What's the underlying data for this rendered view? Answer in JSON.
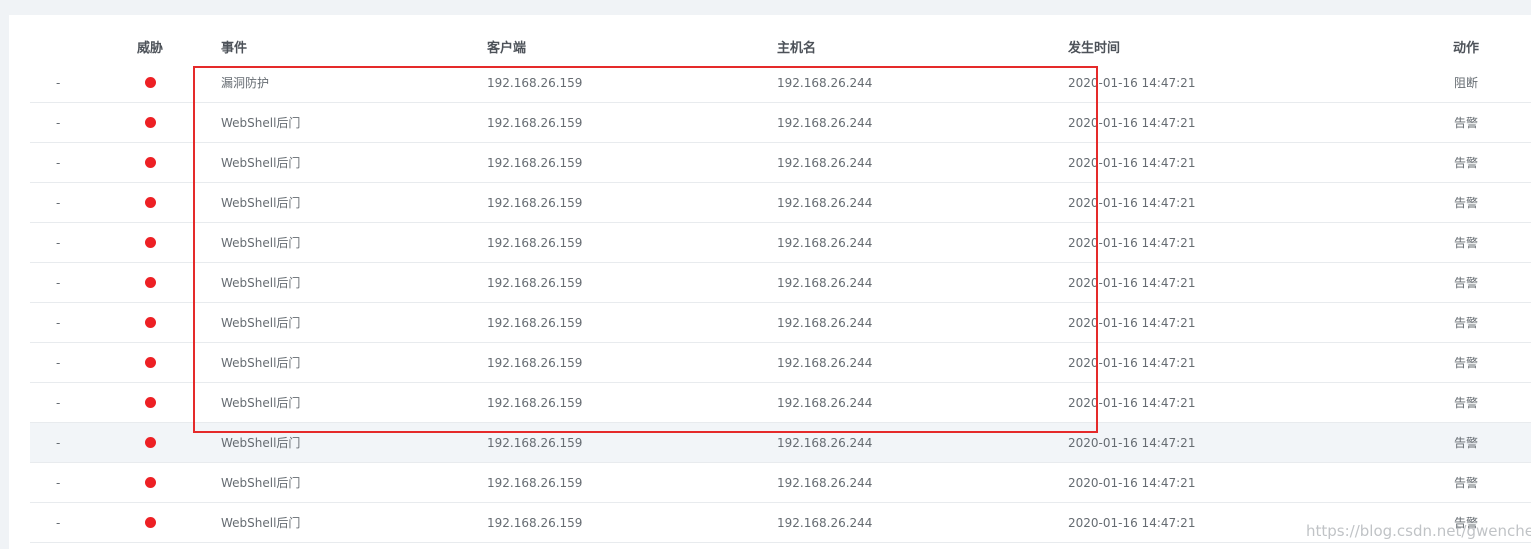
{
  "table": {
    "headers": {
      "threat": "威胁",
      "event": "事件",
      "client": "客户端",
      "host": "主机名",
      "time": "发生时间",
      "action": "动作"
    },
    "rows": [
      {
        "dash": "-",
        "threat": "high",
        "event": "漏洞防护",
        "client": "192.168.26.159",
        "host": "192.168.26.244",
        "time": "2020-01-16 14:47:21",
        "action": "阻断"
      },
      {
        "dash": "-",
        "threat": "high",
        "event": "WebShell后门",
        "client": "192.168.26.159",
        "host": "192.168.26.244",
        "time": "2020-01-16 14:47:21",
        "action": "告警"
      },
      {
        "dash": "-",
        "threat": "high",
        "event": "WebShell后门",
        "client": "192.168.26.159",
        "host": "192.168.26.244",
        "time": "2020-01-16 14:47:21",
        "action": "告警"
      },
      {
        "dash": "-",
        "threat": "high",
        "event": "WebShell后门",
        "client": "192.168.26.159",
        "host": "192.168.26.244",
        "time": "2020-01-16 14:47:21",
        "action": "告警"
      },
      {
        "dash": "-",
        "threat": "high",
        "event": "WebShell后门",
        "client": "192.168.26.159",
        "host": "192.168.26.244",
        "time": "2020-01-16 14:47:21",
        "action": "告警"
      },
      {
        "dash": "-",
        "threat": "high",
        "event": "WebShell后门",
        "client": "192.168.26.159",
        "host": "192.168.26.244",
        "time": "2020-01-16 14:47:21",
        "action": "告警"
      },
      {
        "dash": "-",
        "threat": "high",
        "event": "WebShell后门",
        "client": "192.168.26.159",
        "host": "192.168.26.244",
        "time": "2020-01-16 14:47:21",
        "action": "告警"
      },
      {
        "dash": "-",
        "threat": "high",
        "event": "WebShell后门",
        "client": "192.168.26.159",
        "host": "192.168.26.244",
        "time": "2020-01-16 14:47:21",
        "action": "告警"
      },
      {
        "dash": "-",
        "threat": "high",
        "event": "WebShell后门",
        "client": "192.168.26.159",
        "host": "192.168.26.244",
        "time": "2020-01-16 14:47:21",
        "action": "告警"
      },
      {
        "dash": "-",
        "threat": "high",
        "event": "WebShell后门",
        "client": "192.168.26.159",
        "host": "192.168.26.244",
        "time": "2020-01-16 14:47:21",
        "action": "告警"
      },
      {
        "dash": "-",
        "threat": "high",
        "event": "WebShell后门",
        "client": "192.168.26.159",
        "host": "192.168.26.244",
        "time": "2020-01-16 14:47:21",
        "action": "告警"
      },
      {
        "dash": "-",
        "threat": "high",
        "event": "WebShell后门",
        "client": "192.168.26.159",
        "host": "192.168.26.244",
        "time": "2020-01-16 14:47:21",
        "action": "告警"
      }
    ],
    "hovered_row": 9
  },
  "colors": {
    "threat_dot": "#ed2024",
    "annotation_box": "#e52a2a",
    "hover_row_bg": "#f2f5f8"
  },
  "watermark": "https://blog.csdn.net/gwenchen"
}
